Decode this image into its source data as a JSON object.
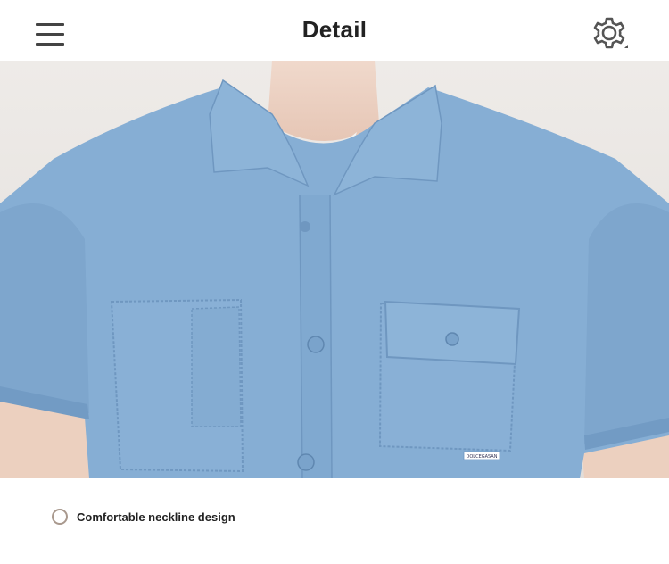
{
  "header": {
    "title": "Detail",
    "menu_icon": "hamburger-menu-icon",
    "settings_icon": "gear-icon"
  },
  "product_image": {
    "description_alt": "Light blue short-sleeve denim shirt with flap chest pockets",
    "tag_text": "DOLCEGASAN"
  },
  "feature": {
    "label": "Comfortable neckline design",
    "bullet_color": "#a9998e"
  },
  "colors": {
    "denim": "#86aed4",
    "denim_dark": "#6f97c0",
    "background": "#ffffff"
  }
}
